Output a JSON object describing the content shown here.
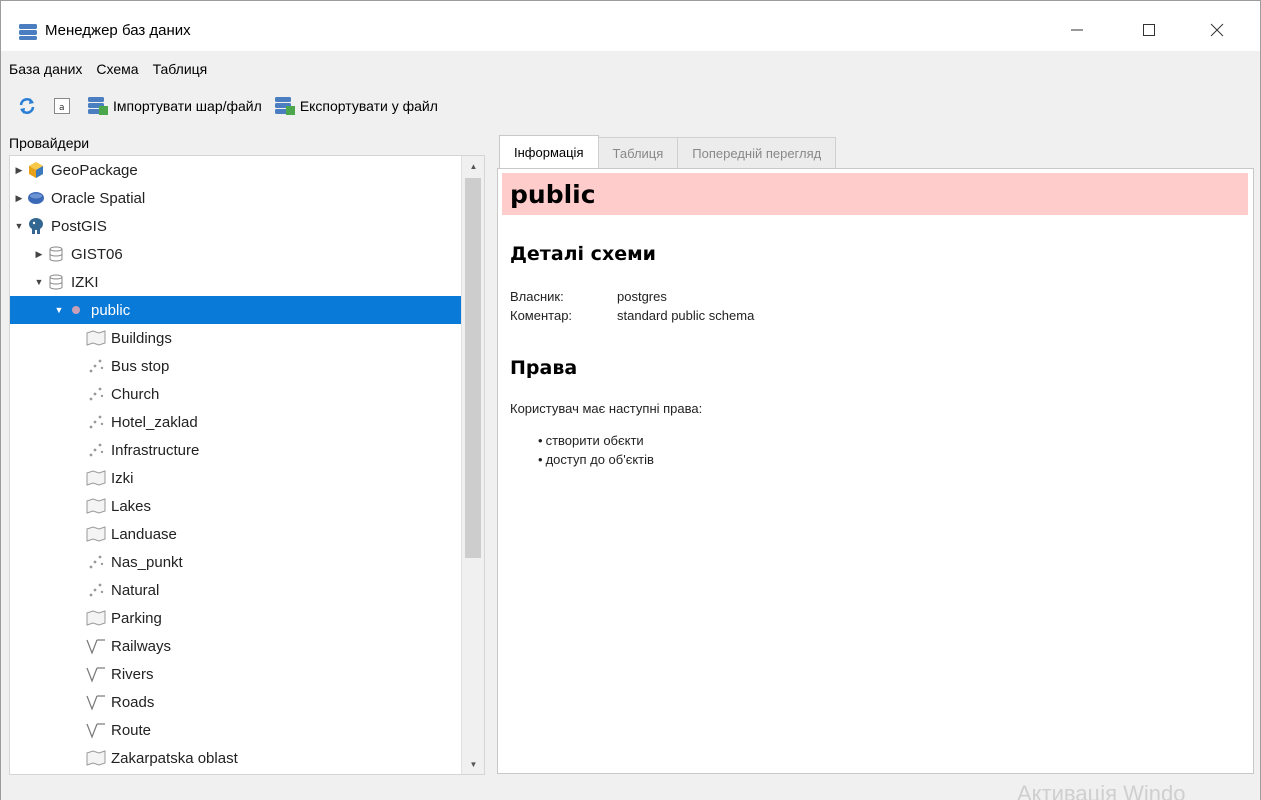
{
  "window": {
    "title": "Менеджер баз даних"
  },
  "menu": [
    {
      "label": "База даних"
    },
    {
      "label": "Схема"
    },
    {
      "label": "Таблиця"
    }
  ],
  "toolbar": {
    "import_label": "Імпортувати шар/файл",
    "export_label": "Експортувати у файл"
  },
  "left_panel": {
    "title": "Провайдери",
    "tree": [
      {
        "label": "GeoPackage",
        "icon": "geopackage-icon",
        "expand": "collapsed",
        "level": 0
      },
      {
        "label": "Oracle Spatial",
        "icon": "oracle-icon",
        "expand": "collapsed",
        "level": 0
      },
      {
        "label": "PostGIS",
        "icon": "postgis-elephant-icon",
        "expand": "expanded",
        "level": 0
      },
      {
        "label": "GIST06",
        "icon": "database-icon",
        "expand": "collapsed",
        "level": 1
      },
      {
        "label": "IZKI",
        "icon": "database-icon",
        "expand": "expanded",
        "level": 1
      },
      {
        "label": "public",
        "icon": "schema-icon",
        "expand": "expanded",
        "level": 2,
        "selected": true
      },
      {
        "label": "Buildings",
        "icon": "polygon-layer-icon",
        "level": 3
      },
      {
        "label": "Bus stop",
        "icon": "point-layer-icon",
        "level": 3
      },
      {
        "label": "Church",
        "icon": "point-layer-icon",
        "level": 3
      },
      {
        "label": "Hotel_zaklad",
        "icon": "point-layer-icon",
        "level": 3
      },
      {
        "label": "Infrastructure",
        "icon": "point-layer-icon",
        "level": 3
      },
      {
        "label": "Izki",
        "icon": "polygon-layer-icon",
        "level": 3
      },
      {
        "label": "Lakes",
        "icon": "polygon-layer-icon",
        "level": 3
      },
      {
        "label": "Landuase",
        "icon": "polygon-layer-icon",
        "level": 3
      },
      {
        "label": "Nas_punkt",
        "icon": "point-layer-icon",
        "level": 3
      },
      {
        "label": "Natural",
        "icon": "point-layer-icon",
        "level": 3
      },
      {
        "label": "Parking",
        "icon": "polygon-layer-icon",
        "level": 3
      },
      {
        "label": "Railways",
        "icon": "line-layer-icon",
        "level": 3
      },
      {
        "label": "Rivers",
        "icon": "line-layer-icon",
        "level": 3
      },
      {
        "label": "Roads",
        "icon": "line-layer-icon",
        "level": 3
      },
      {
        "label": "Route",
        "icon": "line-layer-icon",
        "level": 3
      },
      {
        "label": "Zakarpatska oblast",
        "icon": "polygon-layer-icon",
        "level": 3
      }
    ]
  },
  "tabs": [
    {
      "label": "Інформація",
      "active": true
    },
    {
      "label": "Таблиця",
      "active": false
    },
    {
      "label": "Попередній перегляд",
      "active": false
    }
  ],
  "info": {
    "schema_name": "public",
    "details_heading": "Деталі схеми",
    "owner_label": "Власник:",
    "owner_value": "postgres",
    "comment_label": "Коментар:",
    "comment_value": "standard public schema",
    "rights_heading": "Права",
    "rights_intro": "Користувач має наступні права:",
    "rights": [
      "створити обєкти",
      "доступ до об'єктів"
    ]
  },
  "watermark": "Активація Windo",
  "colors": {
    "selection": "#0a7ad8",
    "schema_header_bg": "#ffcccc"
  }
}
